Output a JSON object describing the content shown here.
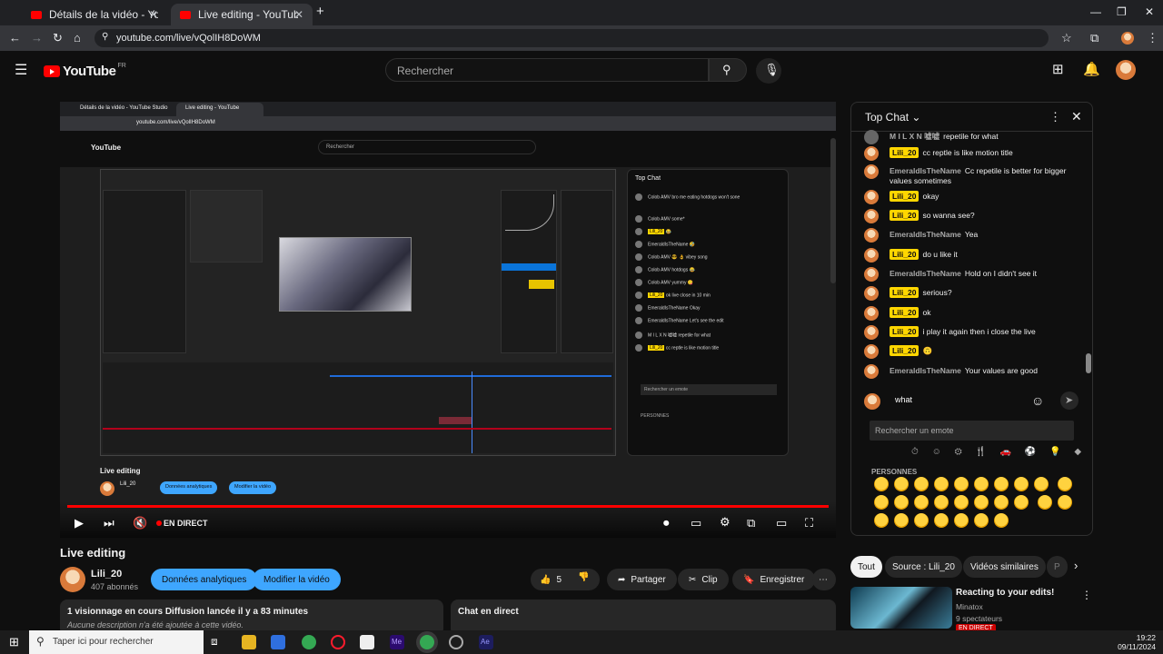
{
  "browser": {
    "tabs": [
      {
        "label": "Détails de la vidéo - YouTube Studio"
      },
      {
        "label": "Live editing - YouTube"
      }
    ],
    "url": "youtube.com/live/vQolIH8DoWM"
  },
  "youtube": {
    "logo_text": "YouTube",
    "region": "FR",
    "search_placeholder": "Rechercher"
  },
  "player": {
    "live_label": "EN DIRECT",
    "inner_title": "Live editing",
    "inner_channel": "Lili_20",
    "inner_analytics": "Données analytiques",
    "inner_edit": "Modifier la vidéo",
    "inner_chat_title": "Top Chat",
    "inner_chat": [
      {
        "author": "Colob AMV",
        "text": "bro me eating hotdogs won't sone"
      },
      {
        "author": "Colob AMV",
        "text": "some*"
      },
      {
        "author": "Lili_20",
        "text": "😂"
      },
      {
        "author": "EmeraldIsTheName",
        "text": "🤣"
      },
      {
        "author": "Colob AMV",
        "text": "😎 👌 vibey song"
      },
      {
        "author": "Colob AMV",
        "text": "hotdogs 😂"
      },
      {
        "author": "Colob AMV",
        "text": "yummy 😋"
      },
      {
        "author": "Lili_20",
        "text": "ok live close in 10 min"
      },
      {
        "author": "EmeraldIsTheName",
        "text": "Okay"
      },
      {
        "author": "EmeraldIsTheName",
        "text": "Let's see the edit"
      },
      {
        "author": "M I L X N 嘘嘘",
        "text": "repetile for what"
      },
      {
        "author": "Lili_20",
        "text": "cc reptle is like motion title"
      }
    ]
  },
  "video": {
    "title": "Live editing",
    "channel": "Lili_20",
    "subscribers": "407 abonnés",
    "analytics_button": "Données analytiques",
    "edit_button": "Modifier la vidéo",
    "likes": "5",
    "share": "Partager",
    "clip": "Clip",
    "save": "Enregistrer",
    "more": "⋯",
    "stats": "1 visionnage en cours  Diffusion lancée il y a 83 minutes",
    "description": "Aucune description n'a été ajoutée à cette vidéo.",
    "live_chat_label": "Chat en direct"
  },
  "chat": {
    "title": "Top Chat",
    "messages": [
      {
        "author": "M I L X N 嘘嘘",
        "text": "repetile for what",
        "owner": false
      },
      {
        "author": "Lili_20",
        "text": "cc reptle is like motion title",
        "owner": true
      },
      {
        "author": "EmeraldIsTheName",
        "text": "Cc repetile is better for bigger values sometimes",
        "owner": false
      },
      {
        "author": "Lili_20",
        "text": "okay",
        "owner": true
      },
      {
        "author": "Lili_20",
        "text": "so wanna see?",
        "owner": true
      },
      {
        "author": "EmeraldIsTheName",
        "text": "Yea",
        "owner": false
      },
      {
        "author": "Lili_20",
        "text": "do u like it",
        "owner": true
      },
      {
        "author": "EmeraldIsTheName",
        "text": "Hold on I didn't see it",
        "owner": false
      },
      {
        "author": "Lili_20",
        "text": "serious?",
        "owner": true
      },
      {
        "author": "Lili_20",
        "text": "ok",
        "owner": true
      },
      {
        "author": "Lili_20",
        "text": "i play it again then i close the live",
        "owner": true
      },
      {
        "author": "Lili_20",
        "text": "🙃",
        "owner": true
      },
      {
        "author": "EmeraldIsTheName",
        "text": "Your values are good",
        "owner": false
      }
    ],
    "input_value": "what",
    "emote_search_placeholder": "Rechercher un emote",
    "emote_section": "PERSONNES",
    "emote_categories": "⏱ ☺ ⚙ 🍴 🚗 ⚽ 💡 ◆"
  },
  "suggestions": {
    "tabs": [
      "Tout",
      "Source : Lili_20",
      "Vidéos similaires",
      "P"
    ],
    "item": {
      "title": "Reacting to your edits!",
      "channel": "Minatox",
      "viewers": "9 spectateurs",
      "live": "EN DIRECT"
    }
  },
  "taskbar": {
    "search_placeholder": "Taper ici pour rechercher",
    "time": "19:22",
    "date": "09/11/2024"
  },
  "colors": {
    "youtube_red": "#ff0000",
    "accent_blue": "#3ea6ff",
    "owner_badge": "#ffd600"
  }
}
